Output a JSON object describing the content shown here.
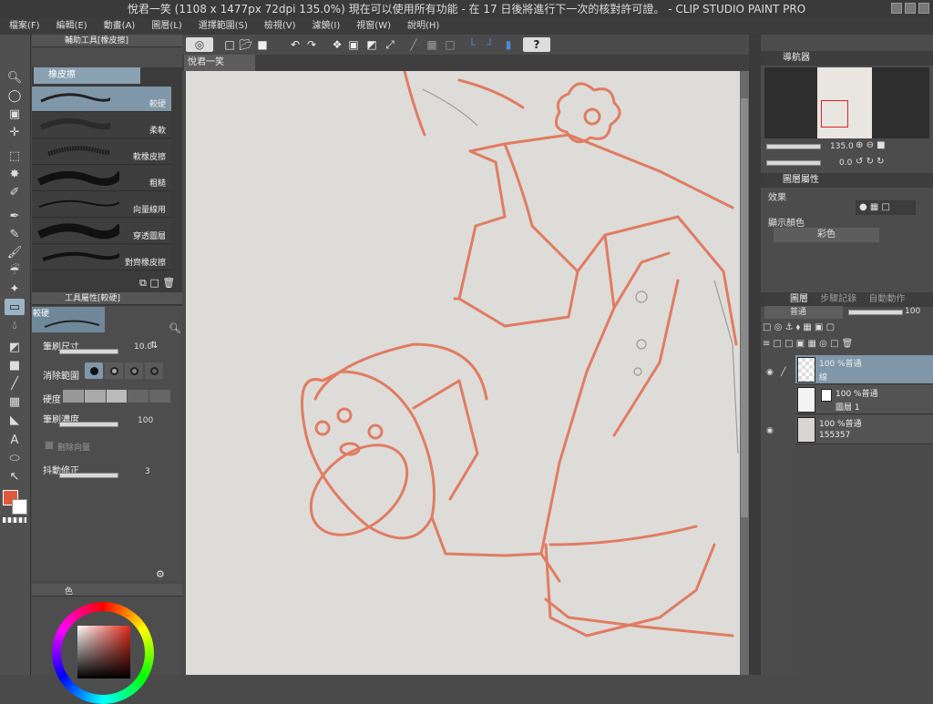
{
  "title": "悅君一笑 (1108 x 1477px 72dpi 135.0%)  現在可以使用所有功能 - 在 17 日後將進行下一次的核對許可證。 - CLIP STUDIO PAINT PRO",
  "menu": [
    "檔案(F)",
    "編輯(E)",
    "動畫(A)",
    "圖層(L)",
    "選擇範圍(S)",
    "檢視(V)",
    "濾鏡(I)",
    "視窗(W)",
    "說明(H)"
  ],
  "sub_tool": {
    "panel_title": "輔助工具[橡皮擦]",
    "group_tab": "橡皮擦",
    "brushes": [
      {
        "label": "較硬"
      },
      {
        "label": "柔軟"
      },
      {
        "label": "軟橡皮擦"
      },
      {
        "label": "粗糙"
      },
      {
        "label": "向量線用"
      },
      {
        "label": "穿透圖層"
      },
      {
        "label": "對齊橡皮擦"
      }
    ]
  },
  "tool_property": {
    "panel_title": "工具屬性[較硬]",
    "preset_name": "較硬",
    "brush_size_label": "筆刷尺寸",
    "brush_size_value": "10.0",
    "erase_range_label": "消除範圍",
    "hardness_label": "硬度",
    "density_label": "筆刷濃度",
    "density_value": "100",
    "vector_erase_label": "刪除向量",
    "stabilization_label": "抖動修正",
    "stabilization_value": "3"
  },
  "color_panel": {
    "title": "色"
  },
  "canvas": {
    "tab_name": "悅君一笑"
  },
  "navigator": {
    "title": "導航器",
    "zoom": "135.0",
    "rotation": "0.0"
  },
  "layer_property": {
    "title": "圖層屬性",
    "effect_label": "效果",
    "display_color_label": "顯示顏色",
    "display_color_value": "彩色"
  },
  "layers_panel": {
    "tabs": [
      "圖層",
      "步驟記錄",
      "自動動作"
    ],
    "blend_mode": "普通",
    "opacity": "100",
    "layers": [
      {
        "line1": "100 %普通",
        "line2": "線"
      },
      {
        "line1": "100 %普通",
        "line2": "圖層 1"
      },
      {
        "line1": "100 %普通",
        "line2": "155357"
      }
    ]
  },
  "colors": {
    "main": "#e05a3a",
    "sub": "#ffffff",
    "line_color": "#e07c62"
  }
}
